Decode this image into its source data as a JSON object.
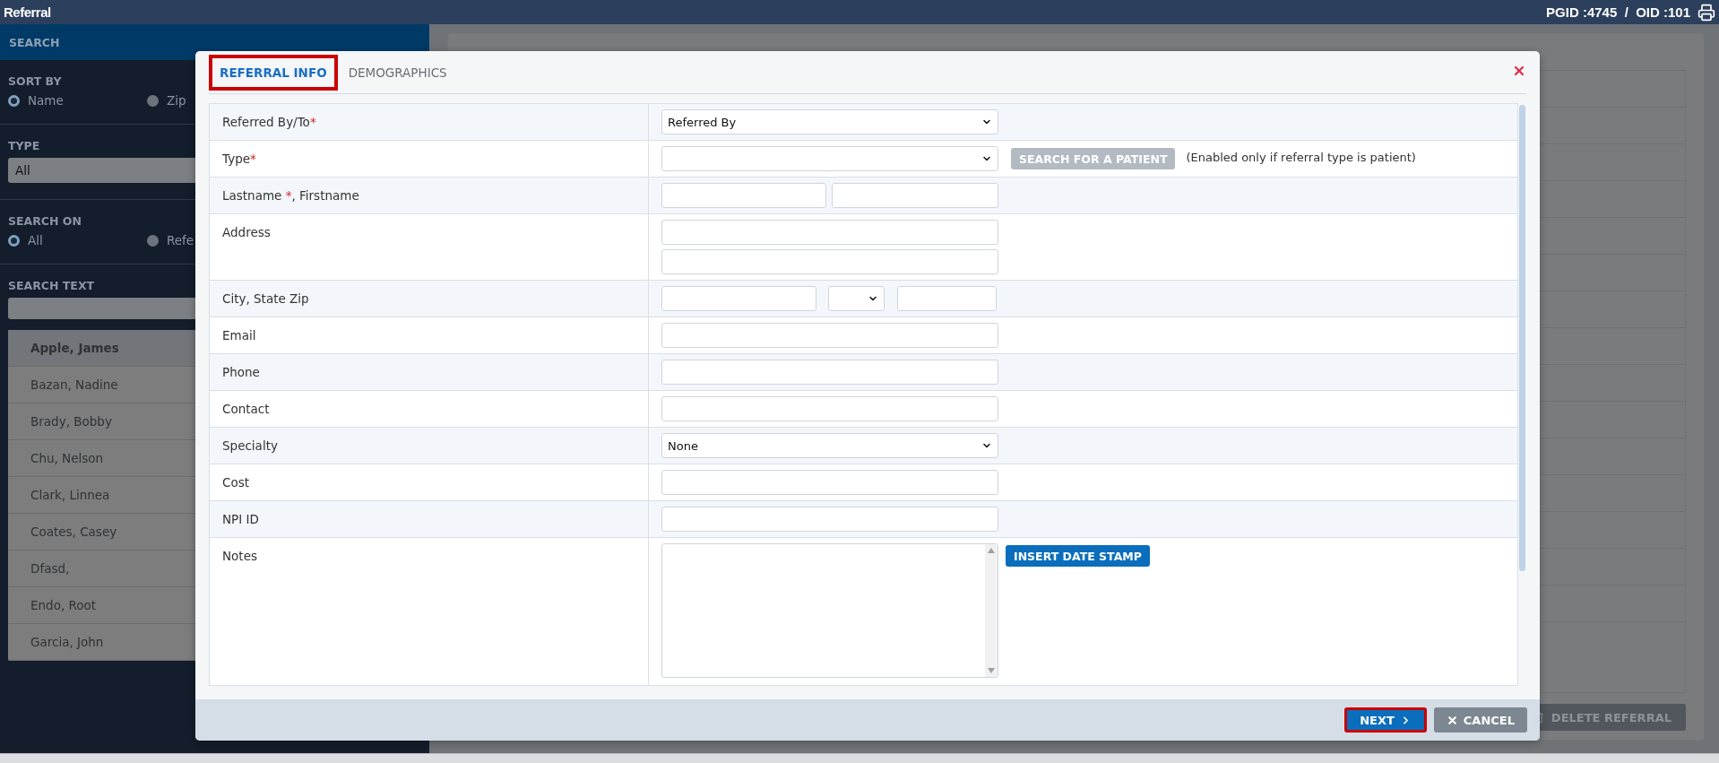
{
  "title_bar": {
    "title": "Referral",
    "ids": "PGID :4745  /  OID :101"
  },
  "sidebar": {
    "header": "SEARCH",
    "sort_by": {
      "label": "SORT BY",
      "options": [
        {
          "label": "Name",
          "selected": true
        },
        {
          "label": "Zip",
          "selected": false
        }
      ]
    },
    "type": {
      "label": "TYPE",
      "value": "All"
    },
    "search_on": {
      "label": "SEARCH ON",
      "options": [
        {
          "label": "All",
          "selected": true
        },
        {
          "label": "Refe",
          "selected": false
        }
      ]
    },
    "search_text": {
      "label": "SEARCH TEXT"
    },
    "results": [
      {
        "name": "Apple, James",
        "selected": true
      },
      {
        "name": "Bazan, Nadine",
        "selected": false
      },
      {
        "name": "Brady, Bobby",
        "selected": false
      },
      {
        "name": "Chu, Nelson",
        "selected": false
      },
      {
        "name": "Clark, Linnea",
        "selected": false
      },
      {
        "name": "Coates, Casey",
        "selected": false
      },
      {
        "name": "Dfasd,",
        "selected": false
      },
      {
        "name": "Endo, Root",
        "selected": false
      },
      {
        "name": "Garcia, John",
        "selected": false
      }
    ]
  },
  "main": {
    "delete_button": "DELETE REFERRAL"
  },
  "modal": {
    "tabs": [
      {
        "label": "REFERRAL INFO",
        "selected": true,
        "highlighted": true
      },
      {
        "label": "DEMOGRAPHICS",
        "selected": false,
        "highlighted": false
      }
    ],
    "rows": [
      {
        "kind": "select",
        "label": "Referred By/To",
        "mark": "*",
        "value": "Referred By"
      },
      {
        "kind": "select_action",
        "label": "Type",
        "mark": "*",
        "action": {
          "label": "SEARCH FOR A PATIENT",
          "disabled": true
        },
        "hint": "(Enabled only if referral type is patient)"
      },
      {
        "kind": "pair",
        "label": "Lastname ",
        "mark": "*",
        "suffix": ", Firstname"
      },
      {
        "kind": "address",
        "label": "Address"
      },
      {
        "kind": "city_state_zip",
        "label": "City, State Zip"
      },
      {
        "kind": "text",
        "label": "Email"
      },
      {
        "kind": "text",
        "label": "Phone"
      },
      {
        "kind": "text",
        "label": "Contact"
      },
      {
        "kind": "select",
        "label": "Specialty",
        "value": "None"
      },
      {
        "kind": "text",
        "label": "Cost"
      },
      {
        "kind": "text",
        "label": "NPI ID"
      },
      {
        "kind": "notes",
        "label": "Notes",
        "action": {
          "label": "INSERT DATE STAMP",
          "disabled": false
        }
      }
    ],
    "buttons": [
      {
        "label": "NEXT",
        "kind": "primary",
        "highlighted": true
      },
      {
        "label": "CANCEL",
        "kind": "secondary",
        "highlighted": false
      }
    ]
  }
}
